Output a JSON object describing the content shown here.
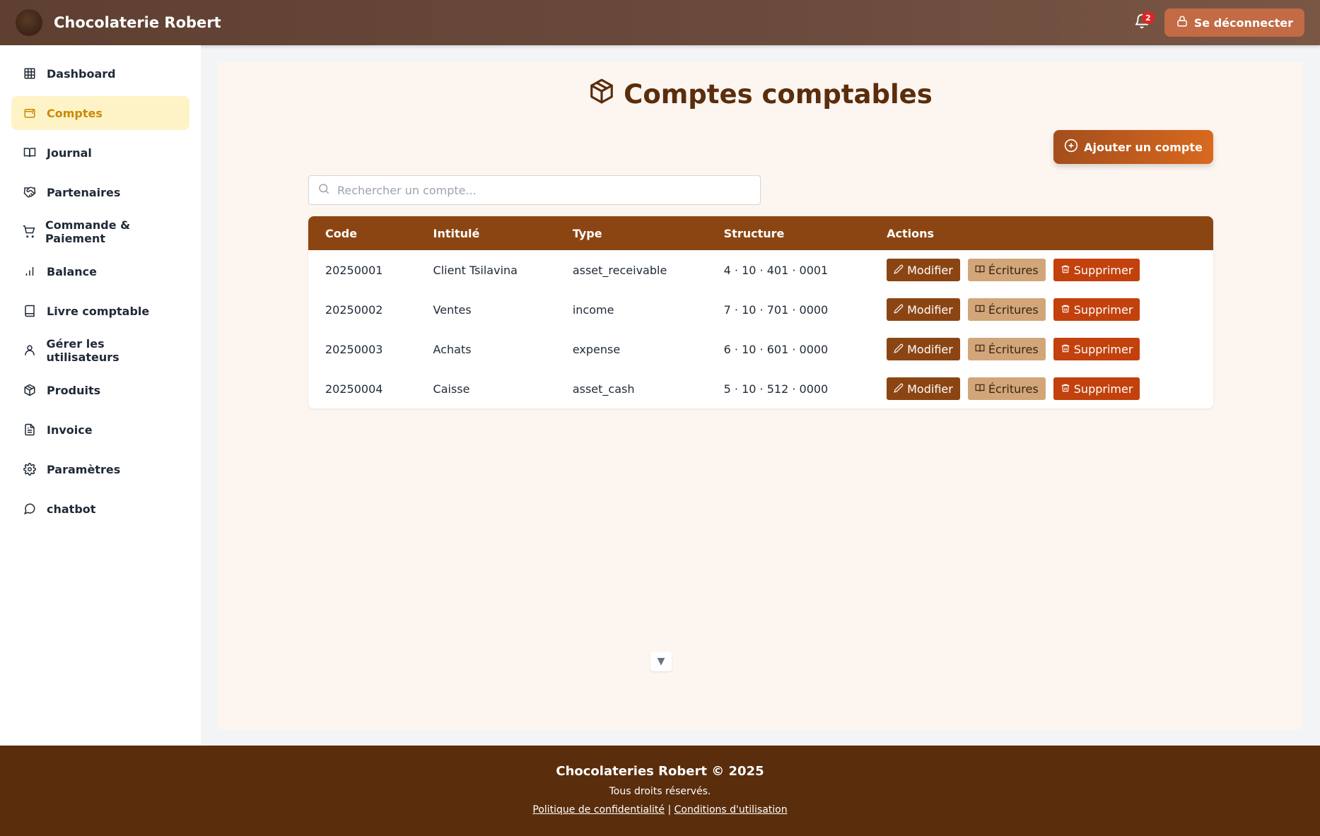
{
  "header": {
    "logo_text": "Robert",
    "brand": "Chocolaterie Robert",
    "notification_count": "2",
    "logout_label": "Se déconnecter"
  },
  "sidebar": {
    "items": [
      {
        "label": "Dashboard",
        "icon": "grid-icon"
      },
      {
        "label": "Comptes",
        "icon": "wallet-icon",
        "active": true
      },
      {
        "label": "Journal",
        "icon": "book-open-icon"
      },
      {
        "label": "Partenaires",
        "icon": "handshake-icon"
      },
      {
        "label": "Commande & Paiement",
        "icon": "cart-icon"
      },
      {
        "label": "Balance",
        "icon": "bar-chart-icon"
      },
      {
        "label": "Livre comptable",
        "icon": "book-icon"
      },
      {
        "label": "Gérer les utilisateurs",
        "icon": "user-icon"
      },
      {
        "label": "Produits",
        "icon": "package-icon"
      },
      {
        "label": "Invoice",
        "icon": "file-text-icon"
      },
      {
        "label": "Paramètres",
        "icon": "gear-icon"
      },
      {
        "label": "chatbot",
        "icon": "chat-bubble-icon"
      }
    ]
  },
  "main": {
    "title": "Comptes comptables",
    "add_button": "Ajouter un compte",
    "search_placeholder": "Rechercher un compte..."
  },
  "table": {
    "headers": [
      "Code",
      "Intitulé",
      "Type",
      "Structure",
      "Actions"
    ],
    "rows": [
      {
        "code": "20250001",
        "label": "Client Tsilavina",
        "type": "asset_receivable",
        "structure": "4 · 10 · 401 · 0001"
      },
      {
        "code": "20250002",
        "label": "Ventes",
        "type": "income",
        "structure": "7 · 10 · 701 · 0000"
      },
      {
        "code": "20250003",
        "label": "Achats",
        "type": "expense",
        "structure": "6 · 10 · 601 · 0000"
      },
      {
        "code": "20250004",
        "label": "Caisse",
        "type": "asset_cash",
        "structure": "5 · 10 · 512 · 0000"
      }
    ],
    "actions": {
      "edit": "Modifier",
      "entries": "Écritures",
      "delete": "Supprimer"
    }
  },
  "footer": {
    "title": "Chocolateries Robert © 2025",
    "rights": "Tous droits réservés.",
    "privacy": "Politique de confidentialité",
    "separator": "|",
    "terms": "Conditions d'utilisation"
  },
  "colors": {
    "header_bg": "#5e3f30",
    "active_bg": "#fef3c7",
    "active_text": "#ca8a04",
    "table_header": "#8b4513",
    "delete_btn": "#c2410c",
    "footer_bg": "#5a2d0c"
  }
}
